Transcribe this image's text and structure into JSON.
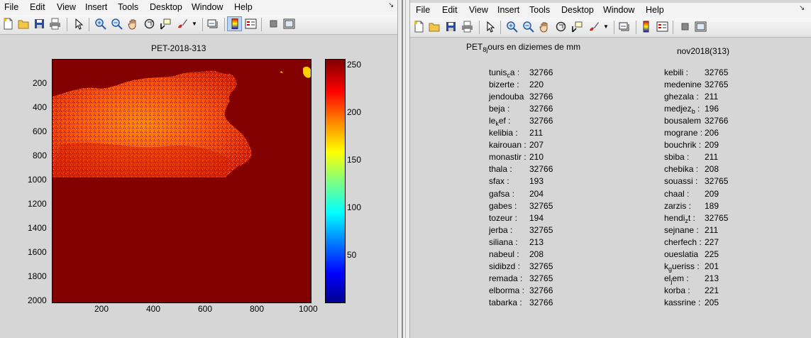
{
  "left_window": {
    "menu": [
      "File",
      "Edit",
      "View",
      "Insert",
      "Tools",
      "Desktop",
      "Window",
      "Help"
    ],
    "dock_glyph": "↘",
    "plot_title": "PET-2018-313",
    "y_ticks": [
      "200",
      "400",
      "600",
      "800",
      "1000",
      "1200",
      "1400",
      "1600",
      "1800",
      "2000"
    ],
    "x_ticks": [
      "200",
      "400",
      "600",
      "800",
      "1000"
    ],
    "colorbar_ticks": [
      "250",
      "200",
      "150",
      "100",
      "50"
    ],
    "colors": {
      "background": "#820000",
      "map_hot": "#ff6a00",
      "map_mid": "#c81c00"
    }
  },
  "right_window": {
    "menu": [
      "File",
      "Edit",
      "View",
      "Insert",
      "Tools",
      "Desktop",
      "Window",
      "Help"
    ],
    "dock_glyph": "↘",
    "title_main": "PET",
    "title_sub": "8j",
    "title_rest": "ours en diziemes de mm",
    "subtitle": "nov2018(313)",
    "left_column": [
      {
        "name": "tunis",
        "sub": "c",
        "suffix": "a :",
        "value": "32766"
      },
      {
        "name": "bizerte :",
        "value": "220"
      },
      {
        "name": "jendouba",
        "value": "32766"
      },
      {
        "name": "beja  :",
        "value": "32766"
      },
      {
        "name": "le",
        "sub": "k",
        "suffix": "ef :",
        "value": "32766"
      },
      {
        "name": "kelibia  :",
        "value": "211"
      },
      {
        "name": "kairouan :",
        "value": "207"
      },
      {
        "name": "monastir :",
        "value": "210"
      },
      {
        "name": "thala  :",
        "value": "32766"
      },
      {
        "name": "sfax  :",
        "value": "193"
      },
      {
        "name": "gafsa  :",
        "value": "204"
      },
      {
        "name": "gabes  :",
        "value": "32765"
      },
      {
        "name": "tozeur :",
        "value": "194"
      },
      {
        "name": "jerba  :",
        "value": "32765"
      },
      {
        "name": "siliana  :",
        "value": "213"
      },
      {
        "name": "nabeul  :",
        "value": "208"
      },
      {
        "name": "sidibzd  :",
        "value": "32765"
      },
      {
        "name": "remada :",
        "value": "32765"
      },
      {
        "name": "elborma :",
        "value": "32766"
      },
      {
        "name": "tabarka :",
        "value": "32766"
      }
    ],
    "right_column": [
      {
        "name": "kebili  :",
        "value": "32765"
      },
      {
        "name": "medenine",
        "value": "32765"
      },
      {
        "name": "ghezala :",
        "value": "211"
      },
      {
        "name": "medjez",
        "sub": "b",
        "suffix": " :",
        "value": "196"
      },
      {
        "name": "bousalem",
        "value": "32766"
      },
      {
        "name": "mograne :",
        "value": "206"
      },
      {
        "name": "bouchrik :",
        "value": "209"
      },
      {
        "name": "sbiba  :",
        "value": "211"
      },
      {
        "name": "chebika :",
        "value": "208"
      },
      {
        "name": "souassi :",
        "value": "32765"
      },
      {
        "name": "chaal  :",
        "value": "209"
      },
      {
        "name": "zarzis  :",
        "value": "189"
      },
      {
        "name": "hendi",
        "sub": "z",
        "suffix": "t :",
        "value": "32765"
      },
      {
        "name": "sejnane :",
        "value": "211"
      },
      {
        "name": "cherfech :",
        "value": "227"
      },
      {
        "name": "oueslatia",
        "value": "225"
      },
      {
        "name": "k",
        "sub": "g",
        "suffix": "ueriss :",
        "value": "201"
      },
      {
        "name": "el",
        "sub": "j",
        "suffix": "em :",
        "value": "213"
      },
      {
        "name": "korba  :",
        "value": "221"
      },
      {
        "name": "kassrine :",
        "value": "205"
      }
    ]
  }
}
